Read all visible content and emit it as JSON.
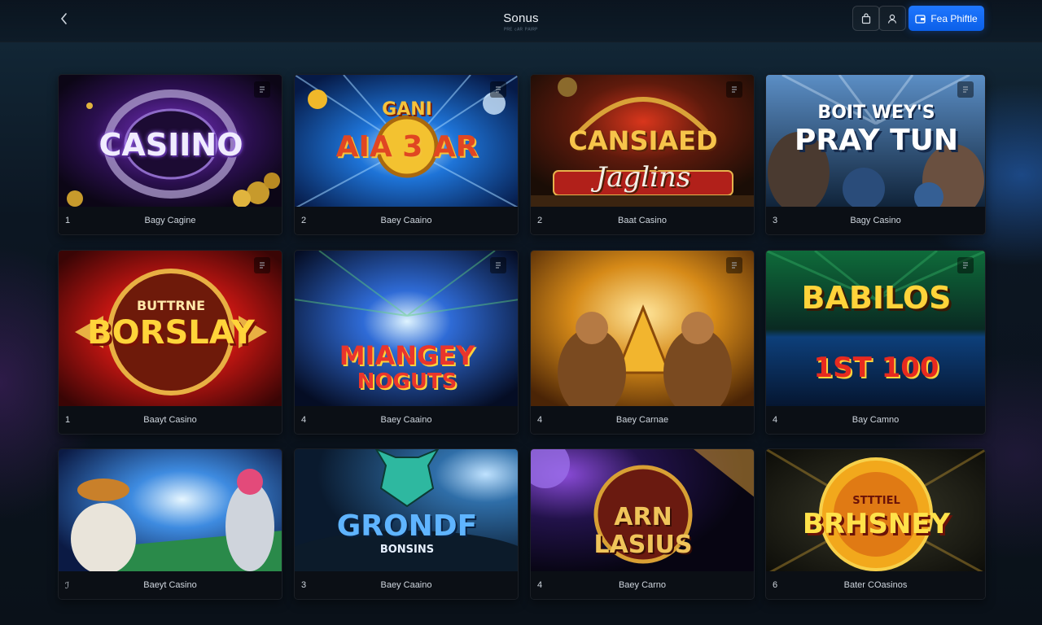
{
  "header": {
    "title": "Sonus",
    "subtitle": "ᴾᴿᴱ ᶜᴬᴿ ᴾᴬᴵᴿᴾ",
    "primary_button": "Fea Phiftle"
  },
  "cards": [
    {
      "number": "1",
      "name": "Bagy Cagine",
      "art": "CASIINO",
      "art2": ""
    },
    {
      "number": "2",
      "name": "Baey Caaino",
      "art": "AIA 3 AR",
      "art2": "GANI"
    },
    {
      "number": "2",
      "name": "Baat Casino",
      "art": "CANSIAED",
      "art2": "Jaglins"
    },
    {
      "number": "3",
      "name": "Bagy Casino",
      "art": "PRAY TUN",
      "art2": "BOIT WEY'S"
    },
    {
      "number": "1",
      "name": "Baayt Casino",
      "art": "BORSLAY",
      "art2": "BUTTRNE"
    },
    {
      "number": "4",
      "name": "Baey Caaino",
      "art": "MIANGEY",
      "art2": "NOGUTS"
    },
    {
      "number": "4",
      "name": "Baey Carnae",
      "art": "",
      "art2": ""
    },
    {
      "number": "4",
      "name": "Bay Camno",
      "art": "BABILOS",
      "art2": "1ST 100"
    },
    {
      "number": "ℐ",
      "name": "Baeyt Casino",
      "art": "",
      "art2": ""
    },
    {
      "number": "3",
      "name": "Baey Caaino",
      "art": "GRONDF",
      "art2": "BONSINS"
    },
    {
      "number": "4",
      "name": "Baey Carno",
      "art": "ARN",
      "art2": "LASIUS"
    },
    {
      "number": "6",
      "name": "Bater COasinos",
      "art": "BRHSNEY",
      "art2": "STTTIEL"
    }
  ],
  "colors": {
    "accent": "#1a6dff",
    "background": "#0c1622",
    "caption_bg": "#0b0f15"
  },
  "icons": {
    "back": "chevron-left-icon",
    "bag": "bag-icon",
    "user": "user-icon",
    "wallet": "wallet-icon",
    "favorite": "bookmark-icon"
  }
}
